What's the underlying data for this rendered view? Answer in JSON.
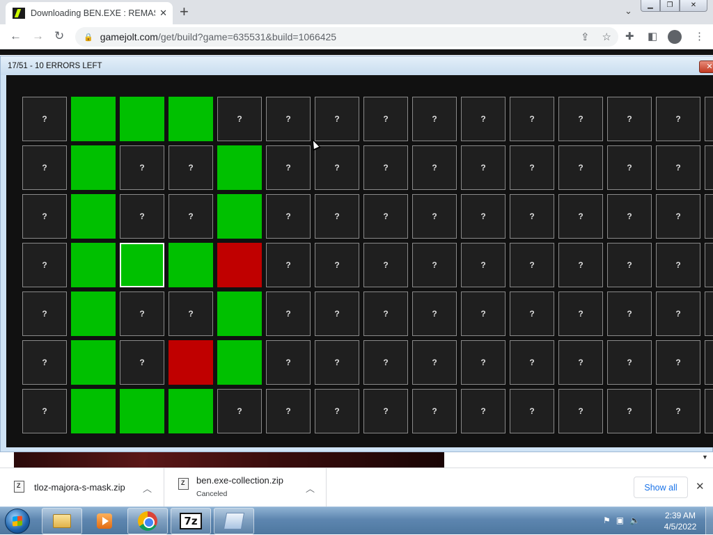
{
  "browser": {
    "tab_title": "Downloading BEN.EXE : REMASTE",
    "url_domain": "gamejolt.com",
    "url_path": "/get/build?game=635531&build=1066425"
  },
  "game": {
    "window_title": "17/51 - 10 ERRORS LEFT",
    "close_glyph": "✕",
    "unknown_glyph": "?",
    "columns_visible": 15,
    "rows": [
      [
        "?",
        "G",
        "G",
        "G",
        "?",
        "?",
        "?",
        "?",
        "?",
        "?",
        "?",
        "?",
        "?",
        "?",
        "?"
      ],
      [
        "?",
        "G",
        "?",
        "?",
        "G",
        "?",
        "?",
        "?",
        "?",
        "?",
        "?",
        "?",
        "?",
        "?",
        "?"
      ],
      [
        "?",
        "G",
        "?",
        "?",
        "G",
        "?",
        "?",
        "?",
        "?",
        "?",
        "?",
        "?",
        "?",
        "?",
        "?"
      ],
      [
        "?",
        "G",
        "S",
        "G",
        "R",
        "?",
        "?",
        "?",
        "?",
        "?",
        "?",
        "?",
        "?",
        "?",
        "?"
      ],
      [
        "?",
        "G",
        "?",
        "?",
        "G",
        "?",
        "?",
        "?",
        "?",
        "?",
        "?",
        "?",
        "?",
        "?",
        "?"
      ],
      [
        "?",
        "G",
        "?",
        "R",
        "G",
        "?",
        "?",
        "?",
        "?",
        "?",
        "?",
        "?",
        "?",
        "?",
        "?"
      ],
      [
        "?",
        "G",
        "G",
        "G",
        "?",
        "?",
        "?",
        "?",
        "?",
        "?",
        "?",
        "?",
        "?",
        "?",
        "?"
      ]
    ],
    "cell_legend": {
      "?": "unrevealed",
      "G": "green",
      "R": "red",
      "S": "green-selected"
    },
    "colors": {
      "green": "#00c000",
      "red": "#c00000",
      "unrevealed": "#1f1f1f"
    }
  },
  "downloads": {
    "items": [
      {
        "name": "tloz-majora-s-mask.zip",
        "status": ""
      },
      {
        "name": "ben.exe-collection.zip",
        "status": "Canceled"
      }
    ],
    "show_all": "Show all"
  },
  "taskbar": {
    "time": "2:39 AM",
    "date": "4/5/2022",
    "sevenzip_label": "7z"
  }
}
